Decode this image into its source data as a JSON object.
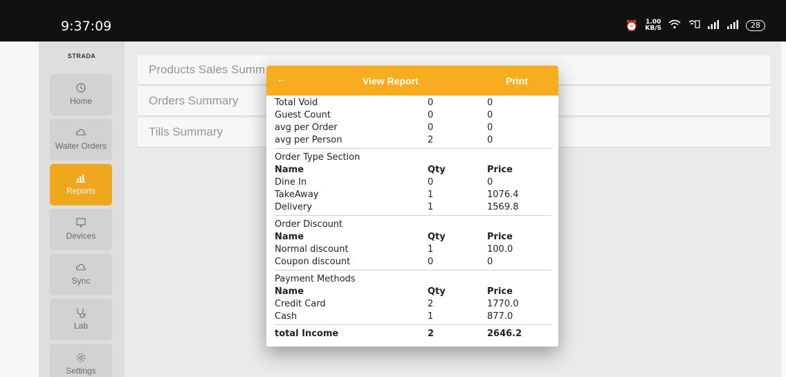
{
  "status_bar": {
    "time": "9:37:09",
    "speed_value": "1.00",
    "speed_unit": "KB/S",
    "battery": "28"
  },
  "sidebar": {
    "brand": "STRADA",
    "items": [
      {
        "label": "Home",
        "icon": "clock-icon"
      },
      {
        "label": "Waiter Orders",
        "icon": "cloud-icon"
      },
      {
        "label": "Reports",
        "icon": "chart-icon",
        "active": true
      },
      {
        "label": "Devices",
        "icon": "monitor-icon"
      },
      {
        "label": "Sync",
        "icon": "cloud-sync-icon"
      },
      {
        "label": "Lab",
        "icon": "stethoscope-icon"
      },
      {
        "label": "Settings",
        "icon": "gear-icon"
      }
    ]
  },
  "main": {
    "items": [
      {
        "label": "Products Sales Summ"
      },
      {
        "label": "Orders Summary"
      },
      {
        "label": "Tills Summary"
      }
    ]
  },
  "dialog": {
    "back_icon": "arrow-left-icon",
    "title": "View Report",
    "print_label": "Print",
    "top_rows": [
      {
        "name": "Total Void",
        "qty": "0",
        "price": "0"
      },
      {
        "name": "Guest Count",
        "qty": "0",
        "price": "0"
      },
      {
        "name": "avg per Order",
        "qty": "0",
        "price": "0"
      },
      {
        "name": "avg per Person",
        "qty": "2",
        "price": "0"
      }
    ],
    "order_type": {
      "title": "Order Type Section",
      "header": {
        "name": "Name",
        "qty": "Qty",
        "price": "Price"
      },
      "rows": [
        {
          "name": "Dine In",
          "qty": "0",
          "price": "0"
        },
        {
          "name": "TakeAway",
          "qty": "1",
          "price": "1076.4"
        },
        {
          "name": "Delivery",
          "qty": "1",
          "price": "1569.8"
        }
      ]
    },
    "order_discount": {
      "title": "Order Discount",
      "header": {
        "name": "Name",
        "qty": "Qty",
        "price": "Price"
      },
      "rows": [
        {
          "name": "Normal discount",
          "qty": "1",
          "price": "100.0"
        },
        {
          "name": "Coupon discount",
          "qty": "0",
          "price": "0"
        }
      ]
    },
    "payment_methods": {
      "title": "Payment Methods",
      "header": {
        "name": "Name",
        "qty": "Qty",
        "price": "Price"
      },
      "rows": [
        {
          "name": "Credit Card",
          "qty": "2",
          "price": "1770.0"
        },
        {
          "name": "Cash",
          "qty": "1",
          "price": "877.0"
        }
      ]
    },
    "total": {
      "name": "total Income",
      "qty": "2",
      "price": "2646.2"
    }
  },
  "colors": {
    "accent": "#f7ad1e",
    "statusbar": "#111111",
    "sidebar": "#e6e6e6",
    "nav_item": "#d9d9d9"
  }
}
